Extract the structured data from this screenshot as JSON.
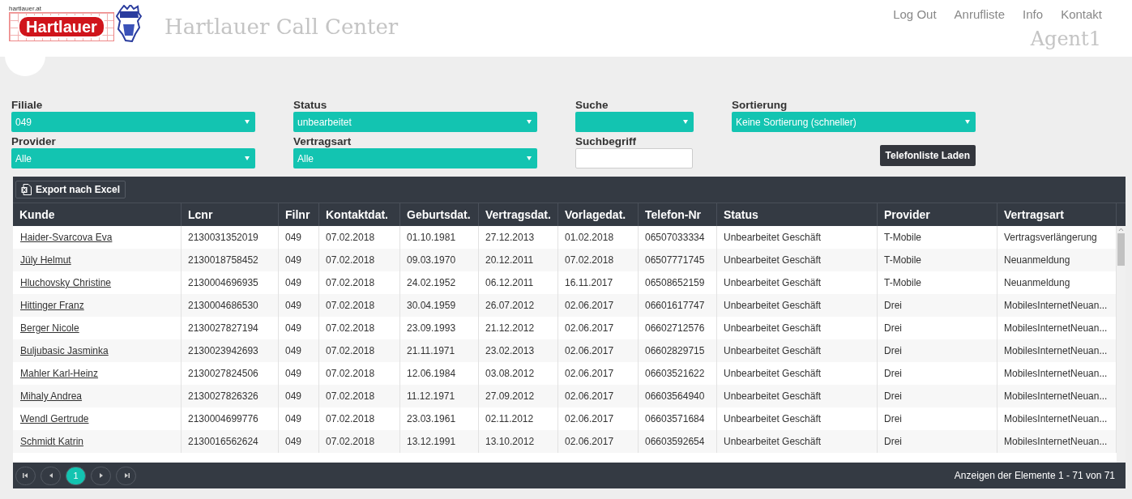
{
  "header": {
    "logo_domain": "hartlauer.at",
    "logo_word": "Hartlauer",
    "title": "Hartlauer Call Center",
    "nav": [
      "Log Out",
      "Anrufliste",
      "Info",
      "Kontakt"
    ],
    "agent": "Agent1"
  },
  "filters": [
    {
      "label": "Filiale",
      "kind": "select",
      "value": "049"
    },
    {
      "label": "Status",
      "kind": "select",
      "value": "unbearbeitet"
    },
    {
      "label": "Suche",
      "kind": "select"
    },
    {
      "label": "Sortierung",
      "kind": "select",
      "value": "Keine Sortierung (schneller)"
    },
    {
      "label": "Provider",
      "kind": "select",
      "value": "Alle"
    },
    {
      "label": "Vertragsart",
      "kind": "select",
      "value": "Alle"
    },
    {
      "label": "Suchbegriff",
      "kind": "input"
    },
    {
      "label": "Telefonliste Laden",
      "kind": "button"
    }
  ],
  "toolbar": {
    "export_button": "Export nach Excel"
  },
  "table": {
    "columns": [
      "Kunde",
      "Lcnr",
      "Filnr",
      "Kontaktdat.",
      "Geburtsdat.",
      "Vertragsdat.",
      "Vorlagedat.",
      "Telefon-Nr",
      "Status",
      "Provider",
      "Vertragsart"
    ],
    "rows": [
      [
        "Haider-Svarcova Eva",
        "2130031352019",
        "049",
        "07.02.2018",
        "01.10.1981",
        "27.12.2013",
        "01.02.2018",
        "06507033334",
        "Unbearbeitet Geschäft",
        "T-Mobile",
        "Vertragsverlängerung"
      ],
      [
        "Jüly Helmut",
        "2130018758452",
        "049",
        "07.02.2018",
        "09.03.1970",
        "20.12.2011",
        "07.02.2018",
        "06507771745",
        "Unbearbeitet Geschäft",
        "T-Mobile",
        "Neuanmeldung"
      ],
      [
        "Hluchovsky Christine",
        "2130004696935",
        "049",
        "07.02.2018",
        "24.02.1952",
        "06.12.2011",
        "16.11.2017",
        "06508652159",
        "Unbearbeitet Geschäft",
        "T-Mobile",
        "Neuanmeldung"
      ],
      [
        "Hittinger Franz",
        "2130004686530",
        "049",
        "07.02.2018",
        "30.04.1959",
        "26.07.2012",
        "02.06.2017",
        "06601617747",
        "Unbearbeitet Geschäft",
        "Drei",
        "MobilesInternetNeuan..."
      ],
      [
        "Berger Nicole",
        "2130027827194",
        "049",
        "07.02.2018",
        "23.09.1993",
        "21.12.2012",
        "02.06.2017",
        "06602712576",
        "Unbearbeitet Geschäft",
        "Drei",
        "MobilesInternetNeuan..."
      ],
      [
        "Buljubasic Jasminka",
        "2130023942693",
        "049",
        "07.02.2018",
        "21.11.1971",
        "23.02.2013",
        "02.06.2017",
        "06602829715",
        "Unbearbeitet Geschäft",
        "Drei",
        "MobilesInternetNeuan..."
      ],
      [
        "Mahler Karl-Heinz",
        "2130027824506",
        "049",
        "07.02.2018",
        "12.06.1984",
        "03.08.2012",
        "02.06.2017",
        "06603521622",
        "Unbearbeitet Geschäft",
        "Drei",
        "MobilesInternetNeuan..."
      ],
      [
        "Mihaly Andrea",
        "2130027826326",
        "049",
        "07.02.2018",
        "11.12.1971",
        "27.09.2012",
        "02.06.2017",
        "06603564940",
        "Unbearbeitet Geschäft",
        "Drei",
        "MobilesInternetNeuan..."
      ],
      [
        "Wendl Gertrude",
        "2130004699776",
        "049",
        "07.02.2018",
        "23.03.1961",
        "02.11.2012",
        "02.06.2017",
        "06603571684",
        "Unbearbeitet Geschäft",
        "Drei",
        "MobilesInternetNeuan..."
      ],
      [
        "Schmidt Katrin",
        "2130016562624",
        "049",
        "07.02.2018",
        "13.12.1991",
        "13.10.2012",
        "02.06.2017",
        "06603592654",
        "Unbearbeitet Geschäft",
        "Drei",
        "MobilesInternetNeuan..."
      ]
    ]
  },
  "pager": {
    "pages": [
      {
        "label": "1",
        "selected": true
      }
    ],
    "info": "Anzeigen der Elemente 1 - 71 von 71"
  }
}
